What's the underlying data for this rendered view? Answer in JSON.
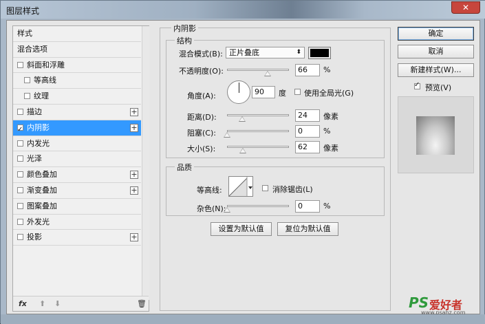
{
  "window": {
    "title": "图层样式",
    "close_label": "✕"
  },
  "left_panel": {
    "items": [
      {
        "label": "样式",
        "checkbox": false,
        "checked": false,
        "plus": false,
        "indent": false,
        "selected": false
      },
      {
        "label": "混合选项",
        "checkbox": false,
        "checked": false,
        "plus": false,
        "indent": false,
        "selected": false
      },
      {
        "label": "斜面和浮雕",
        "checkbox": true,
        "checked": false,
        "plus": false,
        "indent": false,
        "selected": false
      },
      {
        "label": "等高线",
        "checkbox": true,
        "checked": false,
        "plus": false,
        "indent": true,
        "selected": false
      },
      {
        "label": "纹理",
        "checkbox": true,
        "checked": false,
        "plus": false,
        "indent": true,
        "selected": false
      },
      {
        "label": "描边",
        "checkbox": true,
        "checked": false,
        "plus": true,
        "indent": false,
        "selected": false
      },
      {
        "label": "内阴影",
        "checkbox": true,
        "checked": true,
        "plus": true,
        "indent": false,
        "selected": true
      },
      {
        "label": "内发光",
        "checkbox": true,
        "checked": false,
        "plus": false,
        "indent": false,
        "selected": false
      },
      {
        "label": "光泽",
        "checkbox": true,
        "checked": false,
        "plus": false,
        "indent": false,
        "selected": false
      },
      {
        "label": "颜色叠加",
        "checkbox": true,
        "checked": false,
        "plus": true,
        "indent": false,
        "selected": false
      },
      {
        "label": "渐变叠加",
        "checkbox": true,
        "checked": false,
        "plus": true,
        "indent": false,
        "selected": false
      },
      {
        "label": "图案叠加",
        "checkbox": true,
        "checked": false,
        "plus": false,
        "indent": false,
        "selected": false
      },
      {
        "label": "外发光",
        "checkbox": true,
        "checked": false,
        "plus": false,
        "indent": false,
        "selected": false
      },
      {
        "label": "投影",
        "checkbox": true,
        "checked": false,
        "plus": true,
        "indent": false,
        "selected": false
      }
    ],
    "footer": {
      "fx": "fx",
      "up": "⬆",
      "down": "⬇",
      "trash": "🗑"
    }
  },
  "inner_shadow": {
    "section_title": "内阴影",
    "structure": {
      "title": "结构",
      "blend_mode_label": "混合模式(B):",
      "blend_mode_value": "正片叠底",
      "shadow_color": "#000000",
      "opacity_label": "不透明度(O):",
      "opacity_value": "66",
      "opacity_unit": "%",
      "opacity_level": 0.66,
      "angle_label": "角度(A):",
      "angle_value": "90",
      "angle_unit": "度",
      "global_light_label": "使用全局光(G)",
      "global_light_checked": false,
      "distance_label": "距离(D):",
      "distance_value": "24",
      "distance_unit": "像素",
      "distance_level": 0.24,
      "choke_label": "阻塞(C):",
      "choke_value": "0",
      "choke_unit": "%",
      "choke_level": 0,
      "size_label": "大小(S):",
      "size_value": "62",
      "size_unit": "像素",
      "size_level": 0.25
    },
    "quality": {
      "title": "品质",
      "contour_label": "等高线:",
      "antialias_label": "消除锯齿(L)",
      "antialias_checked": false,
      "noise_label": "杂色(N):",
      "noise_value": "0",
      "noise_unit": "%",
      "noise_level": 0
    },
    "set_default_label": "设置为默认值",
    "reset_default_label": "复位为默认值"
  },
  "right_panel": {
    "ok_label": "确定",
    "cancel_label": "取消",
    "new_style_label": "新建样式(W)...",
    "preview_label": "预览(V)",
    "preview_checked": true
  },
  "watermark": {
    "logo": "PS",
    "site_name": "爱好者",
    "url": "www.psahz.com"
  }
}
